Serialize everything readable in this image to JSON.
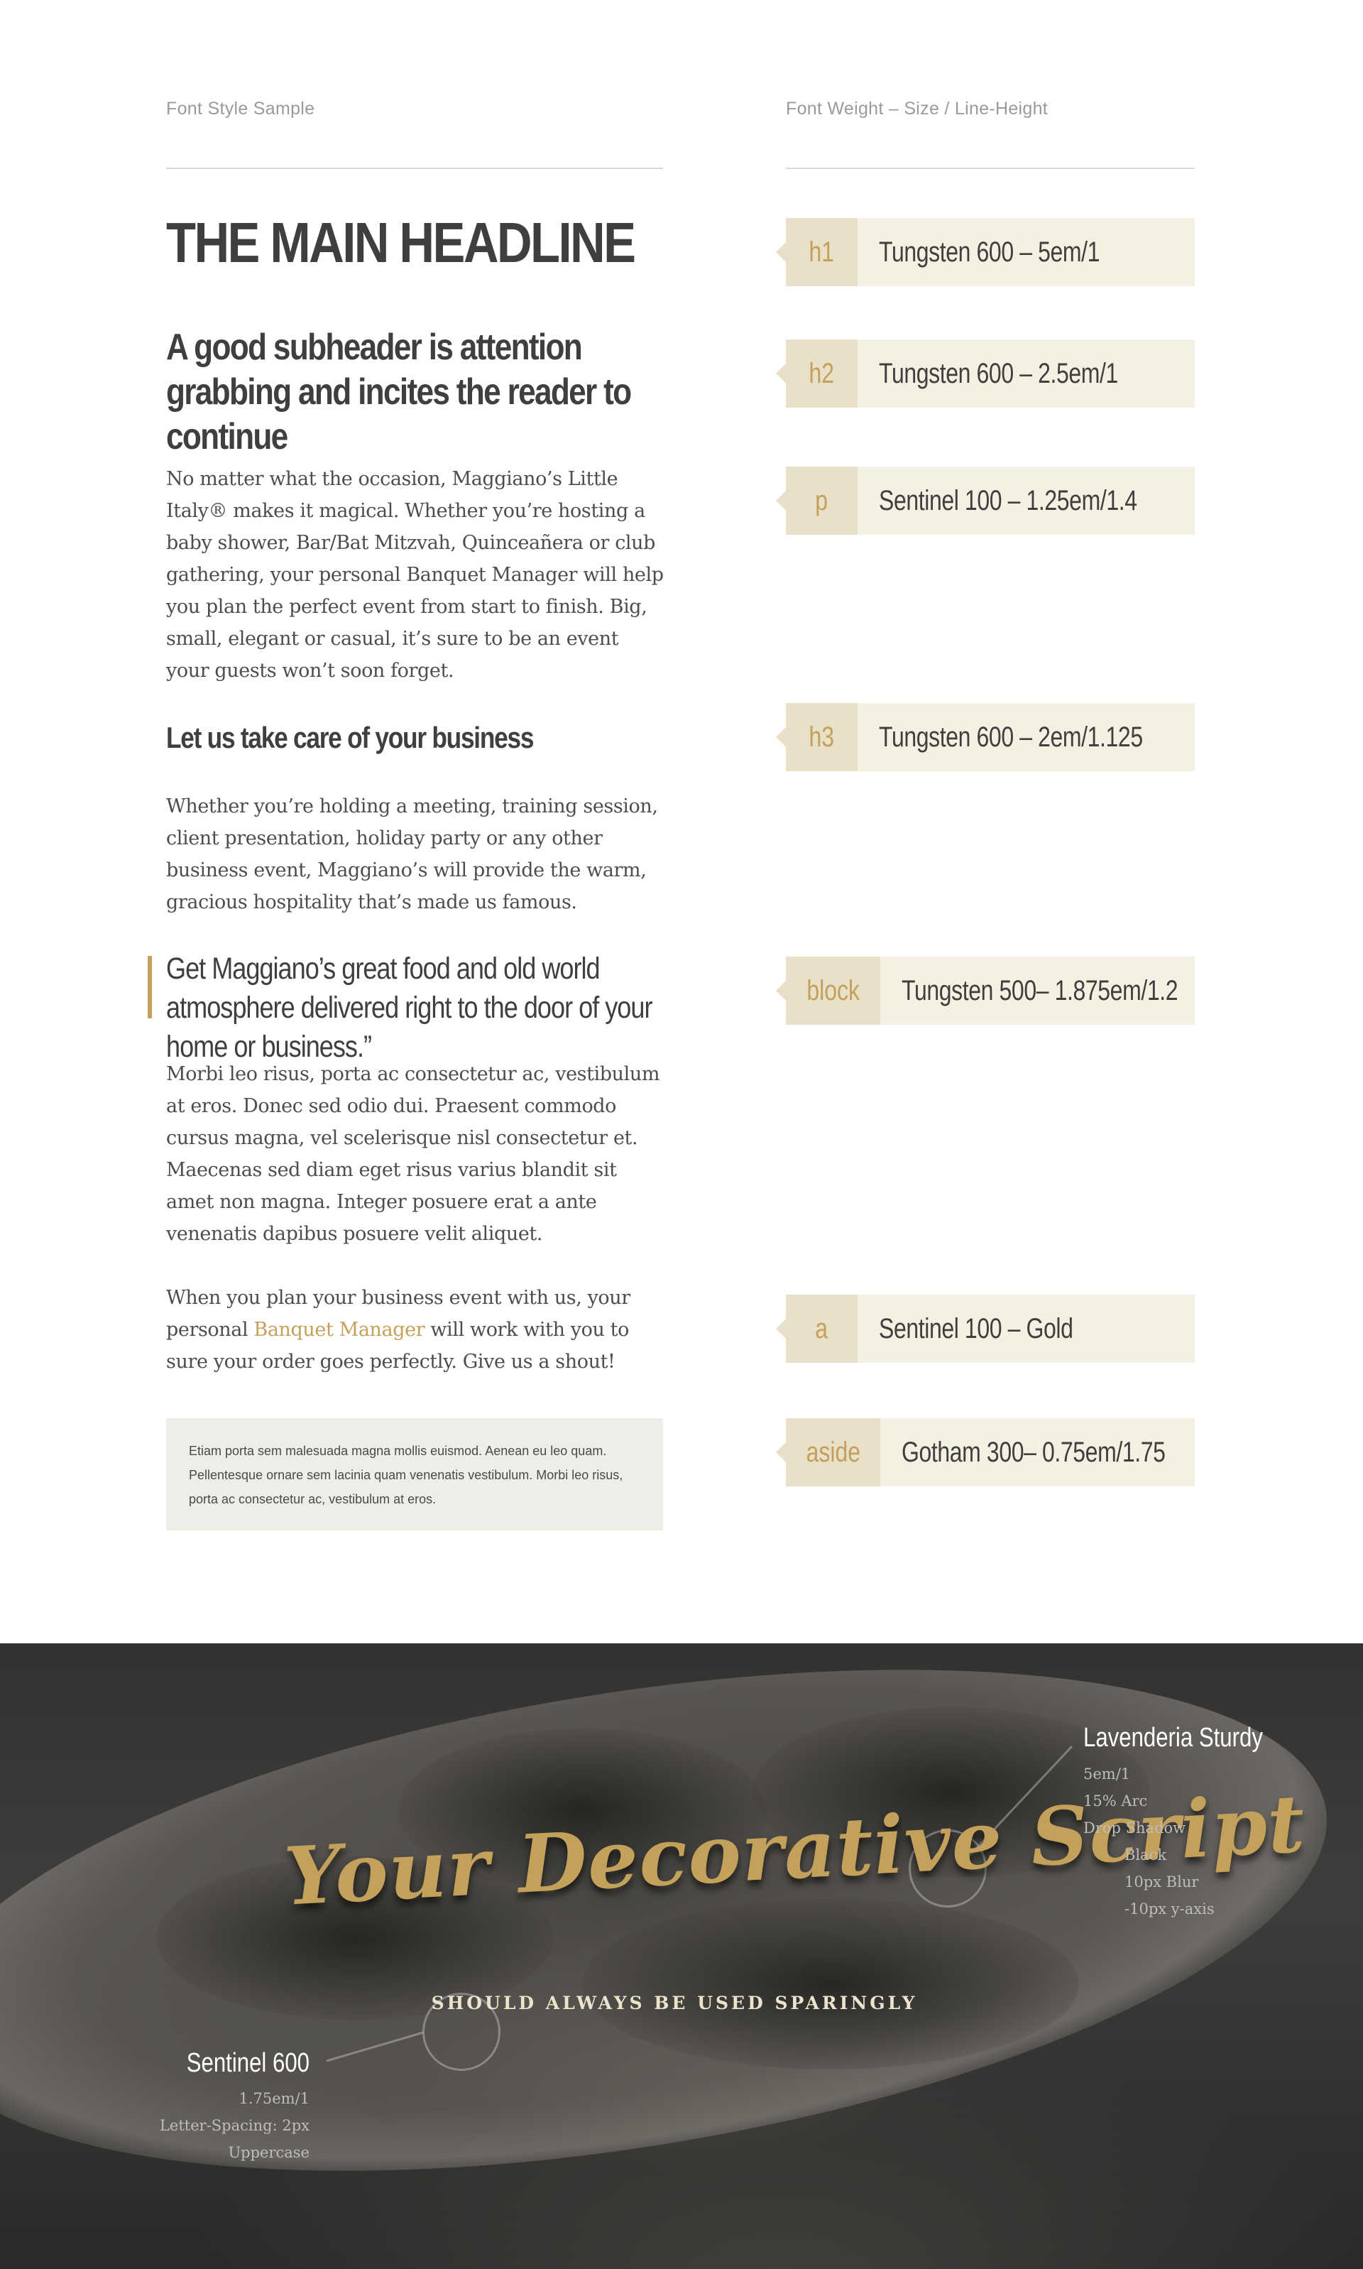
{
  "headers": {
    "left": "Font Style Sample",
    "right": "Font Weight – Size / Line-Height"
  },
  "sample": {
    "h1": "THE MAIN HEADLINE",
    "h2": "A good subheader is attention grabbing and incites the reader to continue",
    "p1": "No matter what the occasion, Maggiano’s Little Italy® makes it magical. Whether you’re hosting a baby shower, Bar/Bat Mitzvah, Quinceañera or club gathering, your personal Banquet Manager will help you plan the perfect event from start to finish. Big, small, elegant or casual, it’s sure to be an event your guests won’t soon forget.",
    "h3": "Let us take care of your business",
    "p2": "Whether you’re holding a meeting, training session, client presentation, holiday party or any other business event, Maggiano’s will provide the warm, gracious hospitality that’s made us famous.",
    "quote": "Get Maggiano’s great food and old world atmosphere delivered right to the door of your home or business.”",
    "p3": "Morbi leo risus, porta ac consectetur ac, vestibulum at eros. Donec sed odio dui. Praesent commodo cursus magna, vel scelerisque nisl consectetur et. Maecenas sed diam eget risus varius blandit sit amet non magna. Integer posuere erat a ante venenatis dapibus posuere velit aliquet.",
    "p4_before": "When you plan your business event with us, your personal ",
    "p4_link": "Banquet Manager",
    "p4_after": " will work with you to sure your order goes perfectly. Give us a shout!",
    "aside": "Etiam porta sem malesuada magna mollis euismod. Aenean eu leo quam. Pellentesque ornare sem lacinia quam venenatis vestibulum. Morbi leo risus, porta ac consectetur ac, vestibulum at eros."
  },
  "specs": [
    {
      "tag": "h1",
      "desc": "Tungsten 600 – 5em/1"
    },
    {
      "tag": "h2",
      "desc": "Tungsten 600 – 2.5em/1"
    },
    {
      "tag": "p",
      "desc": "Sentinel 100 – 1.25em/1.4"
    },
    {
      "tag": "h3",
      "desc": "Tungsten 600 – 2em/1.125"
    },
    {
      "tag": "block",
      "desc": "Tungsten 500– 1.875em/1.2"
    },
    {
      "tag": "a",
      "desc": "Sentinel 100 – Gold"
    },
    {
      "tag": "aside",
      "desc": "Gotham 300– 0.75em/1.75"
    }
  ],
  "decorative": {
    "script": "Your Decorative Script",
    "subtitle": "SHOULD ALWAYS BE USED SPARINGLY",
    "script_spec": {
      "title": "Lavenderia Sturdy",
      "lines": [
        "5em/1",
        "15% Arc",
        "Drop Shadow"
      ],
      "shadow_lines": [
        "Black",
        "10px Blur",
        "-10px y-axis"
      ]
    },
    "subtitle_spec": {
      "title": "Sentinel 600",
      "lines": [
        "1.75em/1",
        "Letter-Spacing: 2px",
        "Uppercase"
      ]
    }
  },
  "colors": {
    "gold": "#c4a15a",
    "tag_bg": "#e8e0c8",
    "spec_bg": "#f4f0e2",
    "aside_bg": "#efede7",
    "text": "#3f3f3f"
  }
}
